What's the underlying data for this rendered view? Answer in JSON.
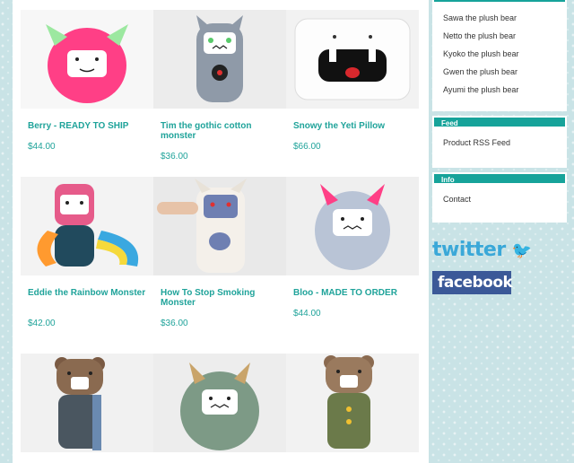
{
  "products": [
    {
      "title": "Berry - READY TO SHIP",
      "price": "$44.00",
      "image": "pink-furry-monster-plush",
      "bg": "#f7f7f7"
    },
    {
      "title": "Tim the gothic cotton monster",
      "price": "$36.00",
      "image": "grey-striped-monster-plush",
      "bg": "#ececec"
    },
    {
      "title": "Snowy the Yeti Pillow",
      "price": "$66.00",
      "image": "white-yeti-pillow",
      "bg": "#f2f2f2"
    },
    {
      "title": "Eddie the Rainbow Monster",
      "price": "$42.00",
      "image": "rainbow-monster-plush",
      "bg": "#f3f3f3"
    },
    {
      "title": "How To Stop Smoking Monster",
      "price": "$36.00",
      "image": "stop-smoking-monster-plush",
      "bg": "#e9e9e9"
    },
    {
      "title": "Bloo - MADE TO ORDER",
      "price": "$44.00",
      "image": "blue-furry-monster-plush",
      "bg": "#efefef"
    },
    {
      "title": "",
      "price": "",
      "image": "brown-bear-plush-scarf",
      "bg": "#f1f1f1"
    },
    {
      "title": "",
      "price": "",
      "image": "green-monster-plush",
      "bg": "#ededed"
    },
    {
      "title": "",
      "price": "",
      "image": "bear-plush-sweater",
      "bg": "#f2f2f2"
    }
  ],
  "sidebar": {
    "bears": [
      "Sawa the plush bear",
      "Netto the plush bear",
      "Kyoko the plush bear",
      "Gwen the plush bear",
      "Ayumi the plush bear"
    ],
    "feed_title": "Feed",
    "feed_link": "Product RSS Feed",
    "info_title": "Info",
    "info_link": "Contact"
  },
  "social": {
    "twitter": "twitter",
    "facebook": "facebook"
  }
}
